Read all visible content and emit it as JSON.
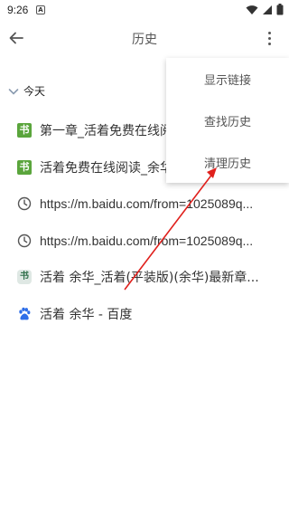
{
  "status_bar": {
    "time": "9:26",
    "notification_badge": "A",
    "icons": [
      "wifi-icon",
      "signal-icon",
      "battery-icon"
    ]
  },
  "app_bar": {
    "title": "历史",
    "back_icon": "back-arrow-icon",
    "more_icon": "more-vert-icon"
  },
  "section": {
    "label": "今天",
    "icon": "chevron-down-icon"
  },
  "history": [
    {
      "icon": "book-site-icon",
      "title": "第一章_活着免费在线阅读"
    },
    {
      "icon": "book-site-icon",
      "title": "活着免费在线阅读_余华"
    },
    {
      "icon": "clock-icon",
      "title": "https://m.baidu.com/from=1025089q..."
    },
    {
      "icon": "clock-icon",
      "title": "https://m.baidu.com/from=1025089q..."
    },
    {
      "icon": "book-app-icon",
      "title": "活着 余华_活着(平装版)(余华)最新章..."
    },
    {
      "icon": "baidu-paw-icon",
      "title": "活着 余华 - 百度"
    }
  ],
  "menu": {
    "items": [
      {
        "label": "显示链接"
      },
      {
        "label": "查找历史"
      },
      {
        "label": "清理历史"
      }
    ]
  },
  "colors": {
    "arrow": "#e0201c",
    "site_icon_green": "#5aa53c",
    "baidu_blue": "#2d6ee8"
  }
}
